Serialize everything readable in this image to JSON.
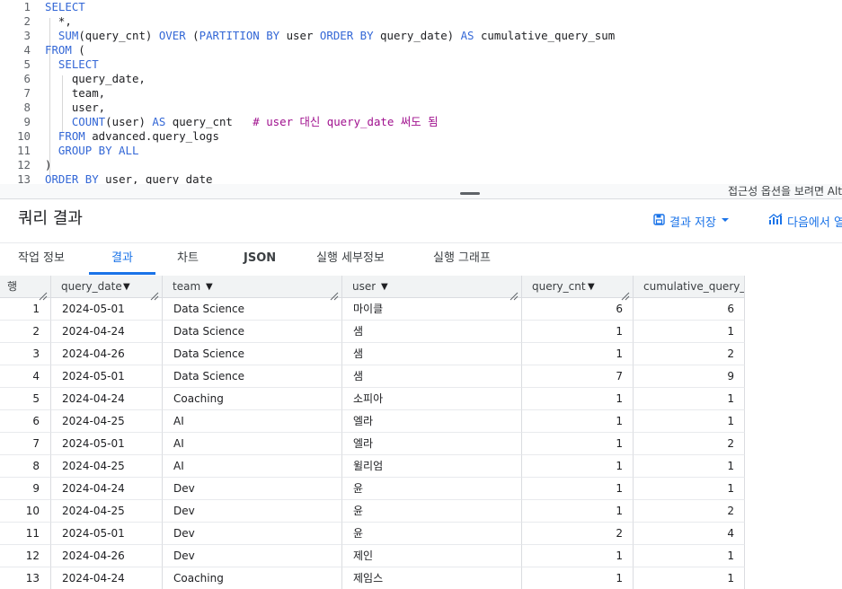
{
  "editor": {
    "lines": [
      {
        "n": "1",
        "code": [
          {
            "t": "SELECT",
            "c": "kw"
          }
        ]
      },
      {
        "n": "2",
        "code": [
          {
            "t": "  *,",
            "c": "id"
          }
        ]
      },
      {
        "n": "3",
        "code": [
          {
            "t": "  ",
            "c": "id"
          },
          {
            "t": "SUM",
            "c": "fn"
          },
          {
            "t": "(query_cnt) ",
            "c": "id"
          },
          {
            "t": "OVER",
            "c": "kw"
          },
          {
            "t": " (",
            "c": "id"
          },
          {
            "t": "PARTITION BY",
            "c": "kw"
          },
          {
            "t": " user ",
            "c": "id"
          },
          {
            "t": "ORDER BY",
            "c": "kw"
          },
          {
            "t": " query_date) ",
            "c": "id"
          },
          {
            "t": "AS",
            "c": "kw"
          },
          {
            "t": " cumulative_query_sum",
            "c": "id"
          }
        ]
      },
      {
        "n": "4",
        "code": [
          {
            "t": "FROM",
            "c": "kw"
          },
          {
            "t": " (",
            "c": "id"
          }
        ]
      },
      {
        "n": "5",
        "code": [
          {
            "t": "  ",
            "c": "id"
          },
          {
            "t": "SELECT",
            "c": "kw"
          }
        ]
      },
      {
        "n": "6",
        "code": [
          {
            "t": "    query_date,",
            "c": "id"
          }
        ]
      },
      {
        "n": "7",
        "code": [
          {
            "t": "    team,",
            "c": "id"
          }
        ]
      },
      {
        "n": "8",
        "code": [
          {
            "t": "    user,",
            "c": "id"
          }
        ]
      },
      {
        "n": "9",
        "code": [
          {
            "t": "    ",
            "c": "id"
          },
          {
            "t": "COUNT",
            "c": "fn"
          },
          {
            "t": "(user) ",
            "c": "id"
          },
          {
            "t": "AS",
            "c": "kw"
          },
          {
            "t": " query_cnt   ",
            "c": "id"
          },
          {
            "t": "# user 대신 query_date 써도 됨",
            "c": "cm"
          }
        ]
      },
      {
        "n": "10",
        "code": [
          {
            "t": "  ",
            "c": "id"
          },
          {
            "t": "FROM",
            "c": "kw"
          },
          {
            "t": " advanced.query_logs",
            "c": "id"
          }
        ]
      },
      {
        "n": "11",
        "code": [
          {
            "t": "  ",
            "c": "id"
          },
          {
            "t": "GROUP BY ALL",
            "c": "kw"
          }
        ]
      },
      {
        "n": "12",
        "code": [
          {
            "t": ")",
            "c": "id"
          }
        ]
      },
      {
        "n": "13",
        "code": [
          {
            "t": "ORDER BY",
            "c": "kw"
          },
          {
            "t": " user, query_date",
            "c": "id"
          }
        ]
      }
    ],
    "a11y_hint": "접근성 옵션을 보려면 Alt"
  },
  "results": {
    "title": "쿼리 결과",
    "save_label": "결과 저장",
    "open_label": "다음에서 열"
  },
  "tabs": [
    "작업 정보",
    "결과",
    "차트",
    "JSON",
    "실행 세부정보",
    "실행 그래프"
  ],
  "active_tab": "결과",
  "table": {
    "row_header": "행",
    "columns": [
      "query_date",
      "team",
      "user",
      "query_cnt",
      "cumulative_query_sum"
    ],
    "rows": [
      [
        "1",
        "2024-05-01",
        "Data Science",
        "마이클",
        "6",
        "6"
      ],
      [
        "2",
        "2024-04-24",
        "Data Science",
        "샘",
        "1",
        "1"
      ],
      [
        "3",
        "2024-04-26",
        "Data Science",
        "샘",
        "1",
        "2"
      ],
      [
        "4",
        "2024-05-01",
        "Data Science",
        "샘",
        "7",
        "9"
      ],
      [
        "5",
        "2024-04-24",
        "Coaching",
        "소피아",
        "1",
        "1"
      ],
      [
        "6",
        "2024-04-25",
        "AI",
        "엘라",
        "1",
        "1"
      ],
      [
        "7",
        "2024-05-01",
        "AI",
        "엘라",
        "1",
        "2"
      ],
      [
        "8",
        "2024-04-25",
        "AI",
        "윌리엄",
        "1",
        "1"
      ],
      [
        "9",
        "2024-04-24",
        "Dev",
        "윤",
        "1",
        "1"
      ],
      [
        "10",
        "2024-04-25",
        "Dev",
        "윤",
        "1",
        "2"
      ],
      [
        "11",
        "2024-05-01",
        "Dev",
        "윤",
        "2",
        "4"
      ],
      [
        "12",
        "2024-04-26",
        "Dev",
        "제인",
        "1",
        "1"
      ],
      [
        "13",
        "2024-04-24",
        "Coaching",
        "제임스",
        "1",
        "1"
      ]
    ]
  },
  "colors": {
    "accent": "#1a73e8",
    "keyword": "#3367d6",
    "comment": "#a0118e"
  }
}
